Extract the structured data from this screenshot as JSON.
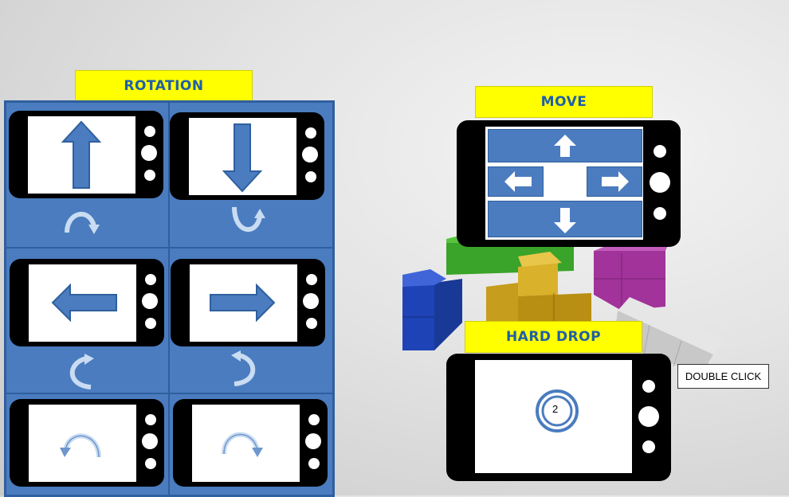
{
  "labels": {
    "rotation": "ROTATION",
    "move": "MOVE",
    "hard_drop": "HARD DROP",
    "double_click": "DOUBLE CLICK"
  },
  "hard_drop_tap_count": "2",
  "rotation_gestures": [
    {
      "tilt": "arrow-up-icon",
      "rotation": "rotate-clockwise-icon"
    },
    {
      "tilt": "arrow-down-icon",
      "rotation": "rotate-counterclockwise-icon"
    },
    {
      "tilt": "arrow-left-icon",
      "rotation": "rotate-counterclockwise-icon"
    },
    {
      "tilt": "arrow-right-icon",
      "rotation": "rotate-clockwise-icon"
    },
    {
      "tilt": "none",
      "rotation": "arc-left-icon"
    },
    {
      "tilt": "none",
      "rotation": "arc-right-icon"
    }
  ],
  "move_buttons": [
    "arrow-up-icon",
    "arrow-left-icon",
    "arrow-right-icon",
    "arrow-down-icon"
  ],
  "colors": {
    "label_bg": "#ffff00",
    "label_text": "#1f5fa8",
    "panel": "#4a7cbf",
    "move_button": "#4a7cbf"
  }
}
